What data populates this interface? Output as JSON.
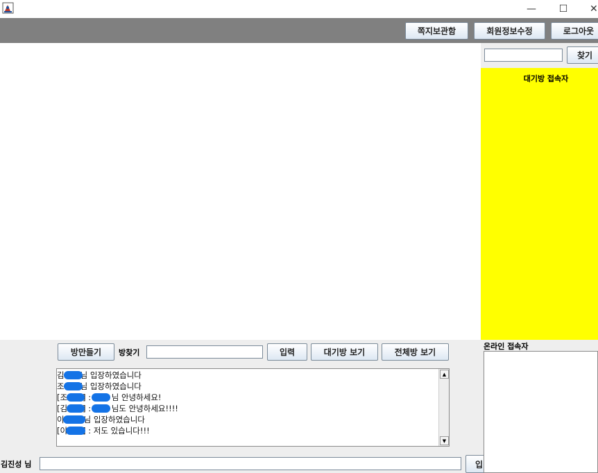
{
  "window": {
    "min_glyph": "—",
    "max_glyph": "☐",
    "close_glyph": "✕"
  },
  "toolbar": {
    "mailbox": "쪽지보관함",
    "edit_profile": "회원정보수정",
    "logout": "로그아웃"
  },
  "user_search": {
    "value": "",
    "button": "찾기"
  },
  "waiting_users": {
    "title": "대기방 접속자",
    "bg_color": "#ffff00"
  },
  "room_controls": {
    "create_room": "방만들기",
    "search_label": "방찾기",
    "search_value": "",
    "enter": "입력",
    "waiting_room_view": "대기방 보기",
    "all_rooms_view": "전체방 보기"
  },
  "chat": {
    "lines": [
      {
        "before": "김",
        "after": "님 입장하였습니다"
      },
      {
        "before": "조",
        "after": "님 입장하였습니다"
      },
      {
        "before": "[조",
        "middle": "] : ",
        "after": "님 안녕하세요!"
      },
      {
        "before": "[김",
        "middle": "] : ",
        "after": "님도 안녕하세요!!!!"
      },
      {
        "before": "이",
        "after": "님 입장하였습니다"
      },
      {
        "before": "[이",
        "middle": "] : 저도 있습니다!!!",
        "after": ""
      }
    ]
  },
  "online": {
    "title": "온라인 접속자"
  },
  "message_input": {
    "nick_label": "김진성 님",
    "value": "",
    "send_partial": "입"
  }
}
